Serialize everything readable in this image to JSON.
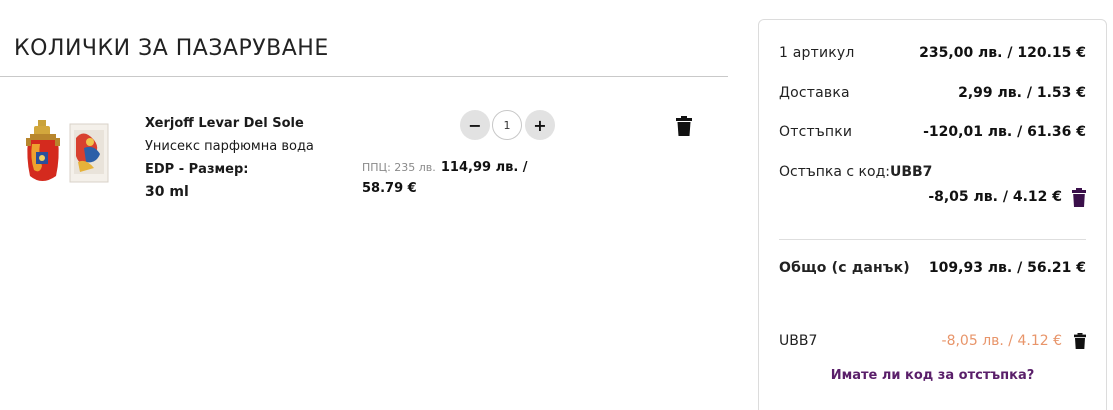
{
  "page": {
    "title": "КОЛИЧКИ ЗА ПАЗАРУВАНЕ"
  },
  "item": {
    "name": "Xerjoff Levar Del Sole",
    "subtype": "Унисекс парфюмна вода",
    "size_prefix": "EDP - Размер:",
    "size_value": "30 ml",
    "rrp": "ППЦ: 235 лв.",
    "price_line1": "114,99 лв. /",
    "price_line2": "58.79 €",
    "quantity": "1",
    "qty_minus": "−",
    "qty_plus": "+"
  },
  "summary": {
    "items_label": "1 артикул",
    "items_value": "235,00 лв. / 120.15 €",
    "delivery_label": "Доставка",
    "delivery_value": "2,99 лв. / 1.53 €",
    "discounts_label": "Отстъпки",
    "discounts_value": "-120,01 лв. / 61.36 €",
    "coupon_label": "Остъпка с код:",
    "coupon_code": "UBB7",
    "coupon_value": "-8,05 лв. / 4.12 €",
    "total_label": "Общо (с данък)",
    "total_value": "109,93 лв. / 56.21 €",
    "applied_code": "UBB7",
    "applied_discount": "-8,05 лв. / 4.12 €",
    "promo_link": "Имате ли код за отстъпка?"
  },
  "icons": {
    "trash": "trash-icon",
    "product": "perfume-bottle-image"
  },
  "colors": {
    "accent_purple": "#5a1f6a",
    "discount_orange": "#e8956a",
    "button_grey": "#e2e2e2"
  }
}
